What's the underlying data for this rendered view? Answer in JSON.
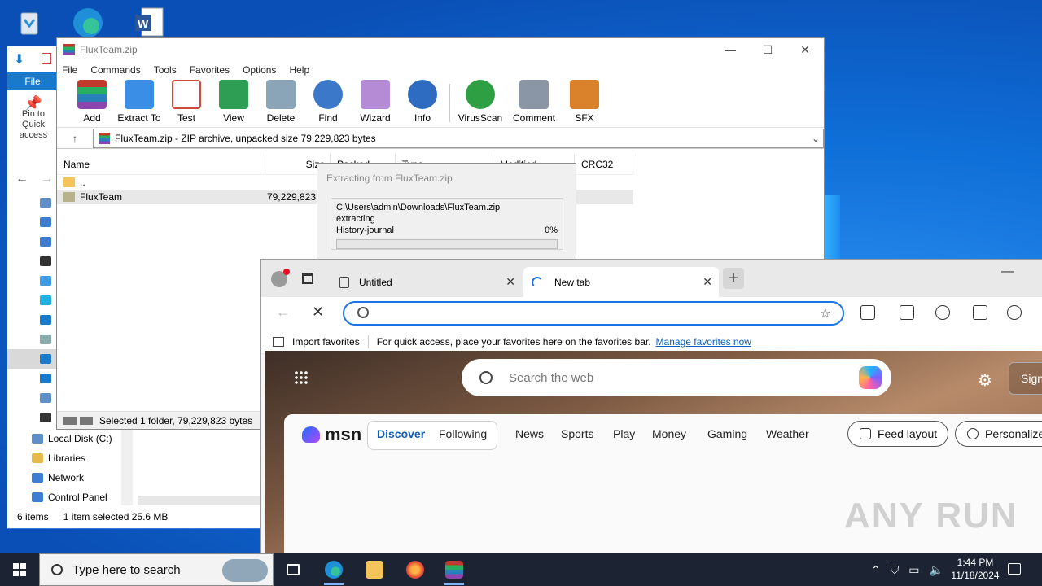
{
  "explorer": {
    "file_tab": "File",
    "pin_label": "Pin to Quick access",
    "tree_lower": [
      {
        "label": "Local Disk (C:)",
        "color": "#5f8fc7"
      },
      {
        "label": "Libraries",
        "color": "#e7b84b"
      },
      {
        "label": "Network",
        "color": "#3f7dd1"
      },
      {
        "label": "Control Panel",
        "color": "#3f7dd1"
      }
    ],
    "status_items": "6 items",
    "status_selected": "1 item selected  25.6 MB"
  },
  "winrar": {
    "title": "FluxTeam.zip",
    "menu": [
      "File",
      "Commands",
      "Tools",
      "Favorites",
      "Options",
      "Help"
    ],
    "toolbar": [
      {
        "label": "Add",
        "icon": "add-icon",
        "color": "#c0392b"
      },
      {
        "label": "Extract To",
        "icon": "extract-folder-icon",
        "color": "#3a8ee6"
      },
      {
        "label": "Test",
        "icon": "test-checklist-icon",
        "color": "#d04a3a"
      },
      {
        "label": "View",
        "icon": "view-book-icon",
        "color": "#2f9e55"
      },
      {
        "label": "Delete",
        "icon": "recycle-bin-icon",
        "color": "#8aa4b8"
      },
      {
        "label": "Find",
        "icon": "magnifier-icon",
        "color": "#3c78c9"
      },
      {
        "label": "Wizard",
        "icon": "magic-wand-icon",
        "color": "#b58bd6"
      },
      {
        "label": "Info",
        "icon": "info-icon",
        "color": "#2d6cc0"
      },
      {
        "label": "VirusScan",
        "icon": "bug-icon",
        "color": "#2ea043"
      },
      {
        "label": "Comment",
        "icon": "comment-icon",
        "color": "#8a96a6"
      },
      {
        "label": "SFX",
        "icon": "sfx-box-icon",
        "color": "#d9822b"
      }
    ],
    "address": "FluxTeam.zip - ZIP archive, unpacked size 79,229,823 bytes",
    "columns": [
      "Name",
      "Size",
      "Packed",
      "Type",
      "Modified",
      "CRC32"
    ],
    "rows": [
      {
        "name": "..",
        "size": ""
      },
      {
        "name": "FluxTeam",
        "size": "79,229,823"
      }
    ],
    "status": "Selected 1 folder, 79,229,823 bytes"
  },
  "extract": {
    "title": "Extracting from FluxTeam.zip",
    "path": "C:\\Users\\admin\\Downloads\\FluxTeam.zip",
    "action": "extracting",
    "file": "History-journal",
    "percent": "0%",
    "progress_value": 0
  },
  "edge": {
    "tabs": [
      {
        "label": "Untitled",
        "close": "✕"
      },
      {
        "label": "New tab",
        "close": "✕"
      }
    ],
    "new_tab": "+",
    "minimize": "—",
    "address_value": "",
    "fav_import": "Import favorites",
    "fav_hint": "For quick access, place your favorites here on the favorites bar.",
    "fav_link": "Manage favorites now",
    "search_placeholder": "Search the web",
    "sign_in": "Sign",
    "msn_logo": "msn",
    "msn_nav": [
      "Discover",
      "Following",
      "News",
      "Sports",
      "Play",
      "Money",
      "Gaming",
      "Weather"
    ],
    "feed_layout": "Feed layout",
    "personalize": "Personalize"
  },
  "watermark": "ANY RUN",
  "taskbar": {
    "search_text": "Type here to search",
    "time": "1:44 PM",
    "date": "11/18/2024"
  }
}
